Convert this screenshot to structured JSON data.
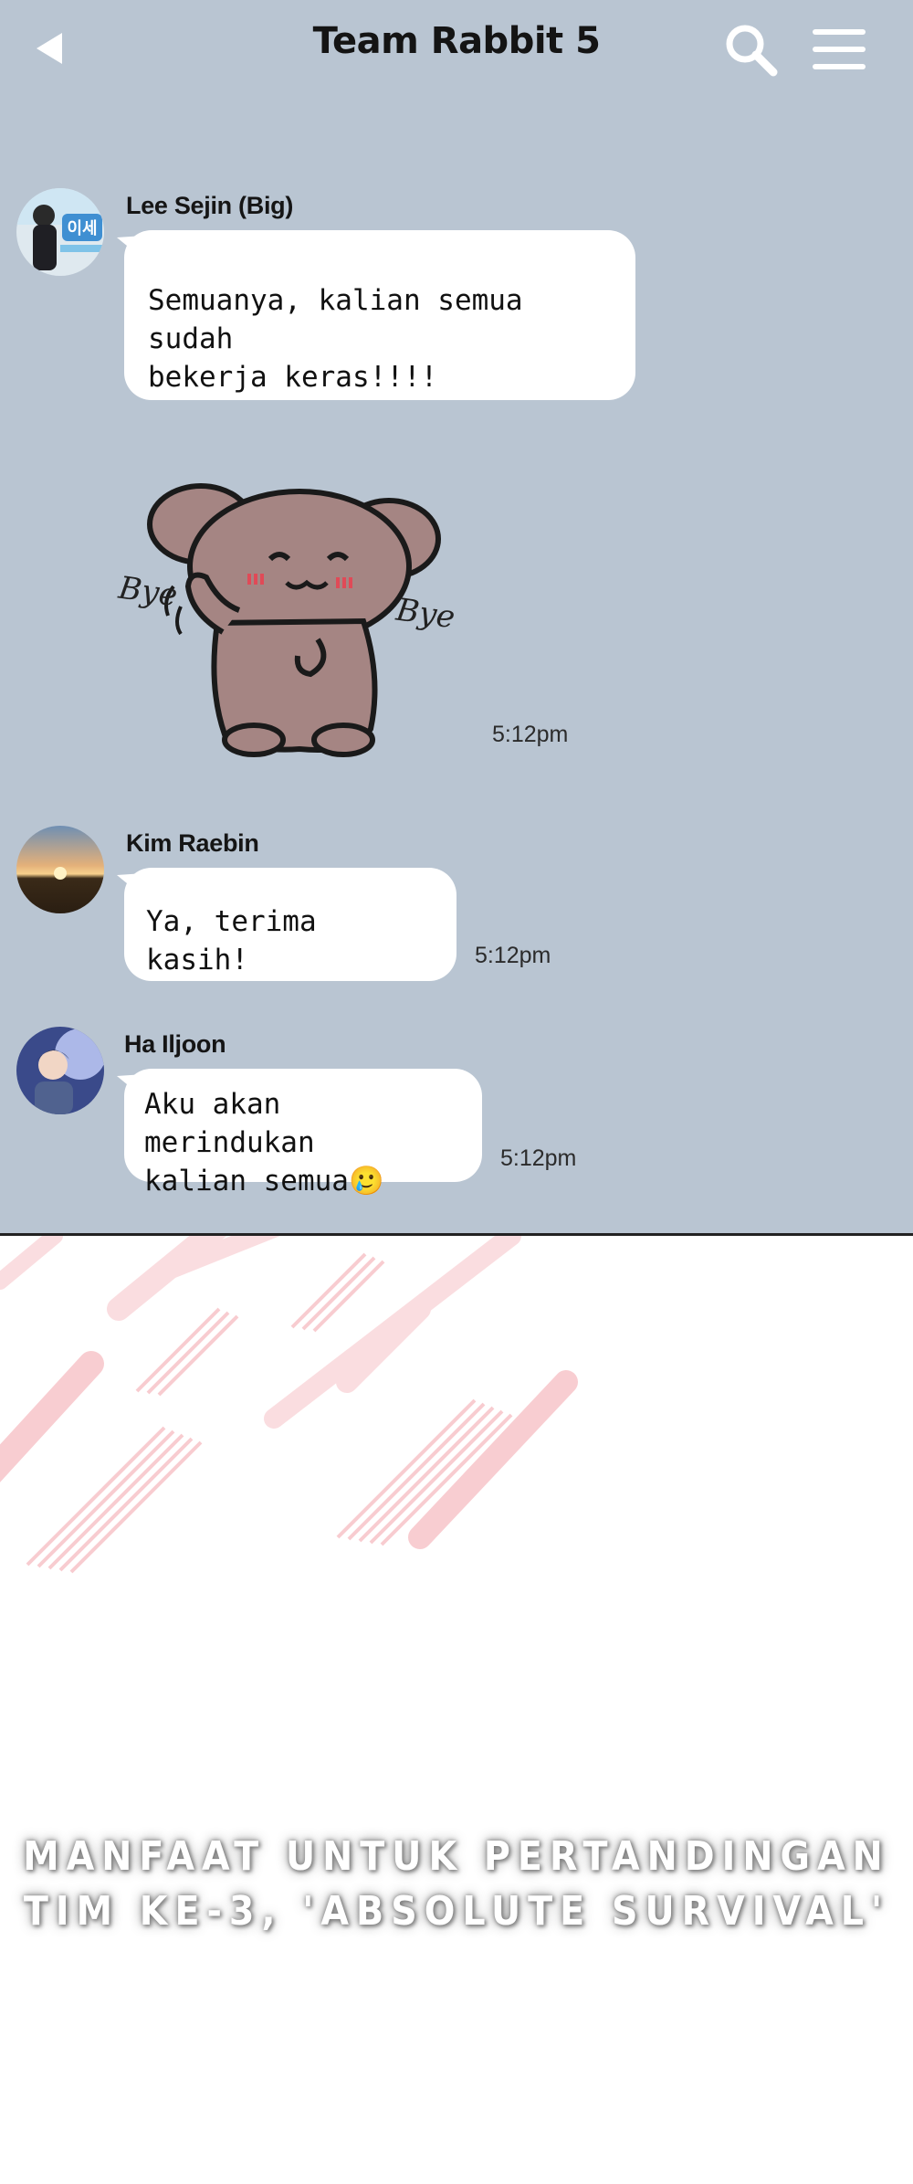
{
  "header": {
    "title": "Team Rabbit 5",
    "back_icon": "back-arrow-icon",
    "search_icon": "search-icon",
    "menu_icon": "hamburger-menu-icon"
  },
  "messages": [
    {
      "sender": "Lee Sejin (Big)",
      "avatar": "avatar-lee-sejin",
      "text": "Semuanya, kalian semua sudah\nbekerja keras!!!!"
    },
    {
      "type": "sticker",
      "sticker_name": "bye-bye-bear-sticker",
      "sticker_text_left": "Bye",
      "sticker_text_right": "Bye",
      "time": "5:12pm"
    },
    {
      "sender": "Kim Raebin",
      "avatar": "avatar-kim-raebin",
      "text": "Ya, terima kasih!",
      "time": "5:12pm"
    },
    {
      "sender": "Ha Iljoon",
      "avatar": "avatar-ha-iljoon",
      "text": "Aku akan merindukan\nkalian semua🥲",
      "time": "5:12pm"
    }
  ],
  "bottom_panel": {
    "caption_line1": "MANFAAT UNTUK PERTANDINGAN",
    "caption_line2": "TIM KE-3, 'ABSOLUTE SURVIVAL'"
  },
  "colors": {
    "chat_background": "#b9c5d2",
    "bubble": "#ffffff",
    "accent_stripes": "#f4a6ad"
  }
}
